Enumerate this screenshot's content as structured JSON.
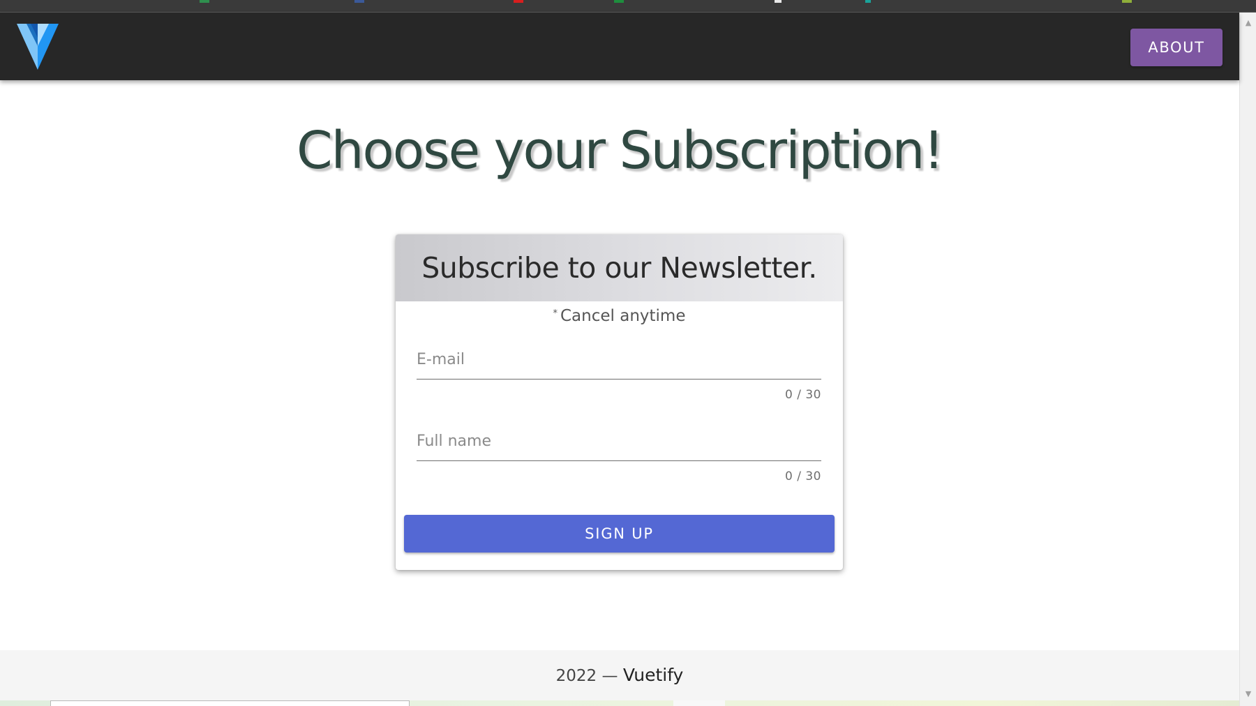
{
  "navbar": {
    "logo_icon": "vuetify-logo-icon",
    "about_label": "ABOUT",
    "colors": {
      "bar": "#272727",
      "about_button": "#7e57a2"
    }
  },
  "hero": {
    "title": "Choose your Subscription!"
  },
  "card": {
    "header": "Subscribe to our Newsletter.",
    "subtitle_mark": "*",
    "subtitle": "Cancel anytime",
    "fields": {
      "email": {
        "placeholder": "E-mail",
        "value": "",
        "counter": "0 / 30"
      },
      "fullname": {
        "placeholder": "Full name",
        "value": "",
        "counter": "0 / 30"
      }
    },
    "signup_label": "SIGN UP",
    "colors": {
      "signup_button": "#5468d4",
      "title_text": "#2f4841"
    }
  },
  "footer": {
    "year": "2022 —",
    "brand": "Vuetify"
  },
  "scrollbar": {
    "up_icon": "scroll-up-arrow-icon",
    "down_icon": "scroll-down-arrow-icon"
  }
}
